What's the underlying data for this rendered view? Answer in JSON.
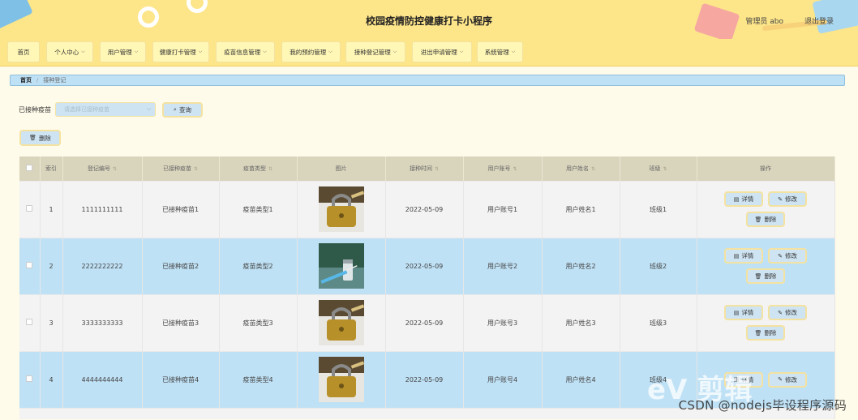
{
  "header": {
    "title": "校园疫情防控健康打卡小程序",
    "user": "管理员 abo",
    "logout": "退出登录"
  },
  "nav": {
    "items": [
      {
        "label": "首页",
        "dropdown": false
      },
      {
        "label": "个人中心",
        "dropdown": true
      },
      {
        "label": "用户管理",
        "dropdown": true
      },
      {
        "label": "健康打卡管理",
        "dropdown": true
      },
      {
        "label": "疫苗信息管理",
        "dropdown": true
      },
      {
        "label": "我的预约管理",
        "dropdown": true
      },
      {
        "label": "接种登记管理",
        "dropdown": true
      },
      {
        "label": "进出申请管理",
        "dropdown": true
      },
      {
        "label": "系统管理",
        "dropdown": true
      }
    ]
  },
  "breadcrumb": {
    "home": "首页",
    "sep": "/",
    "current": "接种登记"
  },
  "search": {
    "label": "已接种疫苗",
    "placeholder": "请选择已接种疫苗",
    "button": "查询",
    "delete_button": "删除"
  },
  "table": {
    "columns": [
      "",
      "索引",
      "登记编号",
      "已接种疫苗",
      "疫苗类型",
      "图片",
      "接种时间",
      "用户账号",
      "用户姓名",
      "班级",
      "操作"
    ],
    "sortable": [
      false,
      false,
      true,
      true,
      true,
      false,
      true,
      true,
      true,
      true,
      false
    ],
    "rows": [
      {
        "index": "1",
        "code": "1111111111",
        "vaccine": "已接种疫苗1",
        "type": "疫苗类型1",
        "image": "lock-photo",
        "date": "2022-05-09",
        "account": "用户账号1",
        "name": "用户姓名1",
        "class": "班级1"
      },
      {
        "index": "2",
        "code": "2222222222",
        "vaccine": "已接种疫苗2",
        "type": "疫苗类型2",
        "image": "vaccine-syringe-photo",
        "date": "2022-05-09",
        "account": "用户账号2",
        "name": "用户姓名2",
        "class": "班级2"
      },
      {
        "index": "3",
        "code": "3333333333",
        "vaccine": "已接种疫苗3",
        "type": "疫苗类型3",
        "image": "lock-photo",
        "date": "2022-05-09",
        "account": "用户账号3",
        "name": "用户姓名3",
        "class": "班级3"
      },
      {
        "index": "4",
        "code": "4444444444",
        "vaccine": "已接种疫苗4",
        "type": "疫苗类型4",
        "image": "lock-photo",
        "date": "2022-05-09",
        "account": "用户账号4",
        "name": "用户姓名4",
        "class": "班级4"
      }
    ],
    "actions": {
      "detail": "详情",
      "edit": "修改",
      "delete": "删除"
    }
  },
  "watermark": {
    "logo": "eV 剪辑",
    "text": "CSDN @nodejs毕设程序源码"
  },
  "colors": {
    "header_bg": "#fde58a",
    "nav_item_bg": "#fff7b5",
    "row_highlight": "#bfe1f5",
    "button_bg": "#cfe4f2",
    "button_border": "#f4e2a0"
  }
}
